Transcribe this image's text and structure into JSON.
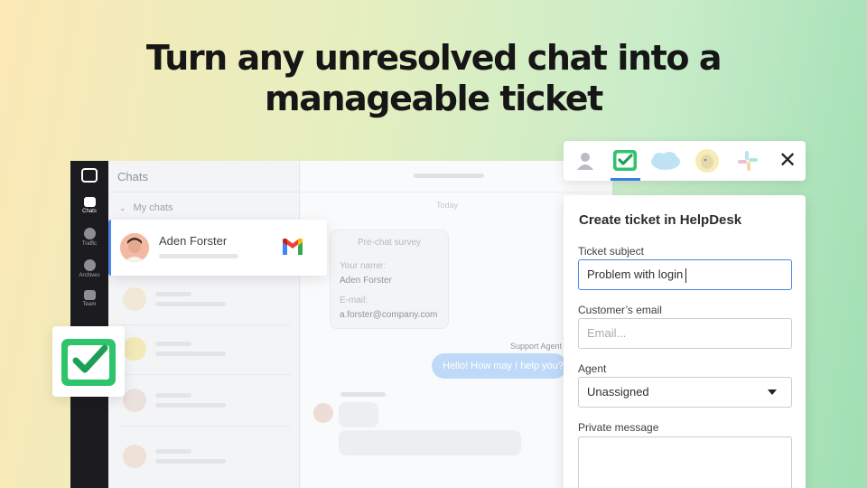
{
  "headline": {
    "line1": "Turn any unresolved chat into a",
    "line2": "manageable ticket"
  },
  "app": {
    "rail": {
      "items": [
        {
          "label": "Chats",
          "icon": "chats-icon",
          "active": true
        },
        {
          "label": "Traffic",
          "icon": "traffic-icon",
          "active": false
        },
        {
          "label": "Archives",
          "icon": "archives-icon",
          "active": false
        },
        {
          "label": "Team",
          "icon": "team-icon",
          "active": false
        }
      ]
    },
    "chatlist": {
      "title": "Chats",
      "section": "My chats"
    },
    "active_chat": {
      "name": "Aden Forster",
      "source_icon": "gmail-icon"
    },
    "conversation": {
      "day_label": "Today",
      "survey": {
        "title": "Pre-chat survey",
        "name_label": "Your name:",
        "name_value": "Aden Forster",
        "email_label": "E-mail:",
        "email_value": "a.forster@company.com"
      },
      "agent_label": "Support Agent",
      "agent_message": "Hello! How may I help you?"
    }
  },
  "integrations": {
    "tabs": [
      "user-icon",
      "helpdesk-icon",
      "salesforce-icon",
      "mailchimp-icon",
      "slack-icon"
    ],
    "active_tab": "helpdesk-icon",
    "close_icon": "close-icon"
  },
  "ticket_form": {
    "title": "Create ticket in HelpDesk",
    "subject_label": "Ticket subject",
    "subject_value": "Problem with login",
    "email_label": "Customer’s email",
    "email_placeholder": "Email...",
    "agent_label": "Agent",
    "agent_value": "Unassigned",
    "message_label": "Private message",
    "message_value": ""
  },
  "colors": {
    "accent": "#4a86e8",
    "helpdesk_green": "#2ec46b",
    "rail_bg": "#1b1b20"
  }
}
